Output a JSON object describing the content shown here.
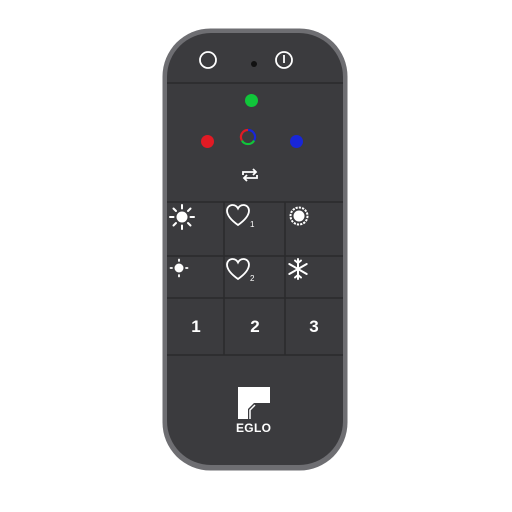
{
  "device": {
    "brand": "EGLO",
    "colors": {
      "body": "#3b3b3e",
      "frame": "#6e6e72",
      "divider": "#2a2a2c",
      "green": "#10c63a",
      "red": "#e11a24",
      "blue": "#1826d8",
      "icon": "#ffffff"
    }
  },
  "top_row": {
    "off_icon": "power-off-icon",
    "on_icon": "power-on-icon"
  },
  "color_buttons": {
    "green_icon": "green-light-icon",
    "red_icon": "red-light-icon",
    "rgb_icon": "rgb-cycle-icon",
    "blue_icon": "blue-light-icon",
    "repeat_icon": "repeat-icon"
  },
  "grid": {
    "favorite_1_badge": "1",
    "favorite_2_badge": "2",
    "keys": [
      "1",
      "2",
      "3"
    ]
  }
}
